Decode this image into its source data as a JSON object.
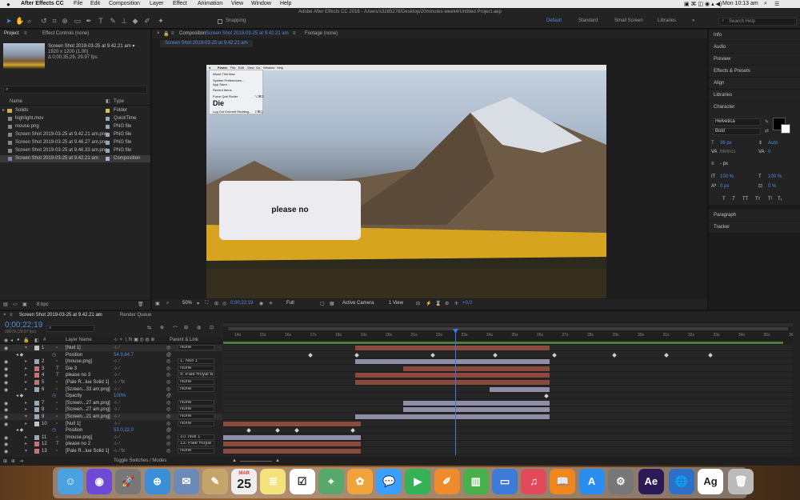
{
  "menubar": {
    "apple": "",
    "app": "After Effects CC",
    "items": [
      "File",
      "Edit",
      "Composition",
      "Layer",
      "Effect",
      "Animation",
      "View",
      "Window",
      "Help"
    ],
    "clock": "Mon 10:13 am"
  },
  "toolbar": {
    "title": "Adobe After Effects CC 2018 - /Users/s3285278/Desktop/20minutes-week4/Untitled Project.aep",
    "snapping": "Snapping",
    "workspaces": [
      "Default",
      "Standard",
      "Small Screen",
      "Libraries"
    ],
    "search_placeholder": "Search Help"
  },
  "project": {
    "tab": "Project",
    "effects_tab": "Effect Controls (none)",
    "item_name": "Screen Shot 2019-03-25 at 9.42.21 am ▾",
    "item_info1": "1920 x 1200 (1.00)",
    "item_info2": "Δ 0;00;35;29, 29.97 fps",
    "col_name": "Name",
    "col_type": "Type",
    "items": [
      {
        "name": "Solids",
        "type": "Folder",
        "color": "#d8c54f"
      },
      {
        "name": "highlight.mov",
        "type": "QuickTime",
        "color": "#9aa7b8"
      },
      {
        "name": "mouse.png",
        "type": "PNG file",
        "color": "#9aa7b8"
      },
      {
        "name": "Screen Shot 2019-03-25 at 9.42.21 am.png",
        "type": "PNG file",
        "color": "#9aa7b8"
      },
      {
        "name": "Screen Shot 2019-03-25 at 9.46.27 am.png",
        "type": "PNG file",
        "color": "#9aa7b8"
      },
      {
        "name": "Screen Shot 2019-03-25 at 9.46.33 am.png",
        "type": "PNG file",
        "color": "#9aa7b8"
      },
      {
        "name": "Screen Shot 2019-03-25 at 9.42.21 am",
        "type": "Composition",
        "color": "#b9a6d6"
      }
    ],
    "bpc": "8 bpc"
  },
  "comp": {
    "header": "Composition",
    "comp_name": "Screen Shot 2019-03-25 at 9.42.21 am",
    "footage": "Footage (none)",
    "tab": "Screen Shot 2019-03-25 at 9.42.21 am",
    "dialog_text": "please no",
    "mac_menu": [
      "Finder",
      "File",
      "Edit",
      "View",
      "Go",
      "Window",
      "Help"
    ],
    "apple_menu": [
      "About This Mac",
      "System Preferences...",
      "App Store...",
      "Recent Items",
      "Force Quit Finder",
      "Die",
      "Log Out Emmett Redding..."
    ],
    "shortcuts": {
      "force": "⌥⌘⎋",
      "logout": "⇧⌘Q"
    },
    "bottom": {
      "zoom": "50%",
      "timecode": "0;00;22;19",
      "quality": "Full",
      "camera": "Active Camera",
      "views": "1 View",
      "exposure": "+0.0"
    }
  },
  "right": {
    "panels": [
      "Info",
      "Audio",
      "Preview",
      "Effects & Presets",
      "Align",
      "Libraries",
      "Character"
    ],
    "font": "Helvetica",
    "style": "Bold",
    "size": "36 px",
    "leading": "Auto",
    "kerning": "Metrics",
    "tracking": "0",
    "stroke": "- px",
    "vscale": "100 %",
    "hscale": "100 %",
    "baseline": "0 px",
    "tsume": "0 %",
    "typo": [
      "T",
      "T",
      "TT",
      "Tт",
      "T¹",
      "T₁"
    ],
    "after": [
      "Paragraph",
      "Tracker"
    ]
  },
  "timeline": {
    "tab": "Screen Shot 2019-03-25 at 9.42.21 am",
    "render": "Render Queue",
    "timecode": "0;00;22;19",
    "frames": "00679 (29.97 fps)",
    "col_layer": "Layer Name",
    "col_parent": "Parent & Link",
    "toggle": "Toggle Switches / Modes",
    "ruler": [
      "14s",
      "15s",
      "16s",
      "17s",
      "18s",
      "19s",
      "20s",
      "21s",
      "22s",
      "23s",
      "24s",
      "25s",
      "26s",
      "27s",
      "28s",
      "29s",
      "30s",
      "31s",
      "32s",
      "33s",
      "34s",
      "35s",
      "36"
    ],
    "rows": [
      {
        "num": "1",
        "name": "[Null 1]",
        "parent": "None",
        "color": "#c4c4c4",
        "indent": 0
      },
      {
        "num": "",
        "name": "Position",
        "value": "54.9,84.7",
        "sub": true
      },
      {
        "num": "2",
        "name": "[mouse.png]",
        "parent": "1. Null 1",
        "color": "#9aa7b8"
      },
      {
        "num": "3",
        "name": "Die 3",
        "parent": "None",
        "color": "#c27576",
        "text": true
      },
      {
        "num": "4",
        "name": "please no 3",
        "parent": "5. Pale Royal B",
        "color": "#c27576",
        "text": true
      },
      {
        "num": "5",
        "name": "[Pale R...lue Solid 1]",
        "parent": "None",
        "color": "#c27576",
        "fx": true
      },
      {
        "num": "6",
        "name": "[Screen...33 am.png]",
        "parent": "None",
        "color": "#9aa7b8"
      },
      {
        "num": "",
        "name": "Opacity",
        "value": "100%",
        "sub": true
      },
      {
        "num": "7",
        "name": "[Screen...27 am.png]",
        "parent": "None",
        "color": "#9aa7b8"
      },
      {
        "num": "8",
        "name": "[Screen...27 am.png]",
        "parent": "None",
        "color": "#9aa7b8"
      },
      {
        "num": "9",
        "name": "[Screen...21 am.png]",
        "parent": "None",
        "color": "#9aa7b8"
      },
      {
        "num": "10",
        "name": "[Null 1]",
        "parent": "None",
        "color": "#c4c4c4"
      },
      {
        "num": "",
        "name": "Position",
        "value": "53.0,22.0",
        "sub": true
      },
      {
        "num": "11",
        "name": "[mouse.png]",
        "parent": "10. Null 1",
        "color": "#9aa7b8"
      },
      {
        "num": "12",
        "name": "please no 2",
        "parent": "13. Pale Royal",
        "color": "#c27576",
        "text": true
      },
      {
        "num": "13",
        "name": "[Pale R...lue Solid 1]",
        "parent": "None",
        "color": "#c27576",
        "fx": true
      }
    ]
  },
  "dock": [
    "Finder",
    "Siri",
    "Launchpad",
    "Safari",
    "Mail Preview",
    "Notes",
    "Calendar",
    "Stickies",
    "Reminders",
    "Maps",
    "Photos",
    "Messages",
    "FaceTime",
    "Pages",
    "Numbers",
    "Keynote",
    "Music",
    "Books",
    "App Store",
    "System Preferences",
    "Ae",
    "Network",
    "Ag",
    "Trash"
  ],
  "calendar": {
    "month": "MAR",
    "day": "25"
  }
}
